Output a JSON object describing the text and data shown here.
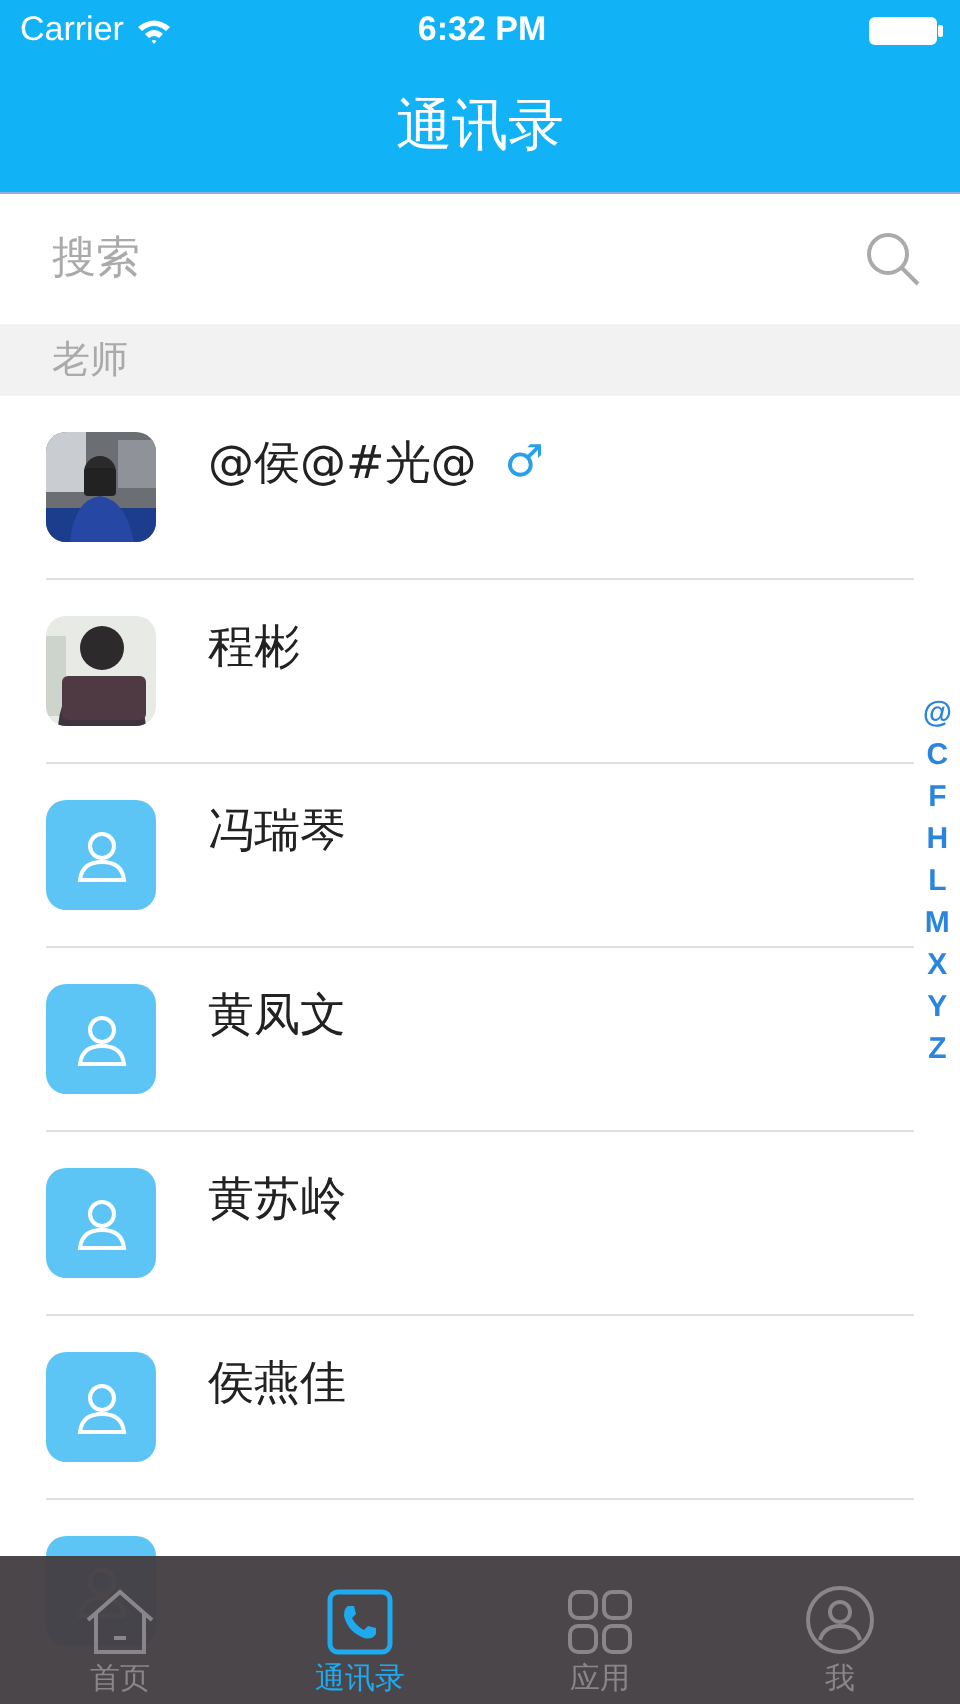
{
  "status_bar": {
    "carrier": "Carrier",
    "time": "6:32 PM"
  },
  "nav": {
    "title": "通讯录"
  },
  "search": {
    "placeholder": "搜索"
  },
  "section": {
    "title": "老师"
  },
  "contacts": [
    {
      "name": "@侯@#光@",
      "gender": "♂"
    },
    {
      "name": "程彬"
    },
    {
      "name": "冯瑞琴",
      "kind": "default"
    },
    {
      "name": "黄凤文",
      "kind": "default"
    },
    {
      "name": "黄苏岭",
      "kind": "default"
    },
    {
      "name": "侯燕佳",
      "kind": "default"
    },
    {
      "kind": "default"
    }
  ],
  "index": [
    "@",
    "C",
    "F",
    "H",
    "L",
    "M",
    "X",
    "Y",
    "Z"
  ],
  "tabs": [
    {
      "label": "首页",
      "kind": "home",
      "selected": false
    },
    {
      "label": "通讯录",
      "kind": "phone",
      "selected": true
    },
    {
      "label": "应用",
      "kind": "grid",
      "selected": false
    },
    {
      "label": "我",
      "kind": "user",
      "selected": false
    }
  ]
}
